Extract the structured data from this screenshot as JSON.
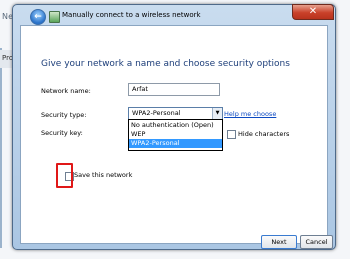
{
  "background": {
    "title": "Netw",
    "strip_label": "Pro"
  },
  "dialog": {
    "close_label": "✕",
    "title": "Manually connect to a wireless network",
    "heading": "Give your network a name and choose security options",
    "fields": {
      "network_name_label": "Network name:",
      "network_name_value": "Arfat",
      "security_type_label": "Security type:",
      "security_type_value": "WPA2-Personal",
      "security_key_label": "Security key:"
    },
    "dropdown_options": [
      "No authentication (Open)",
      "WEP",
      "WPA2-Personal"
    ],
    "help_link": "Help me choose",
    "hide_characters": "Hide characters",
    "save_network": "Save this network",
    "buttons": {
      "next": "Next",
      "cancel": "Cancel"
    }
  }
}
